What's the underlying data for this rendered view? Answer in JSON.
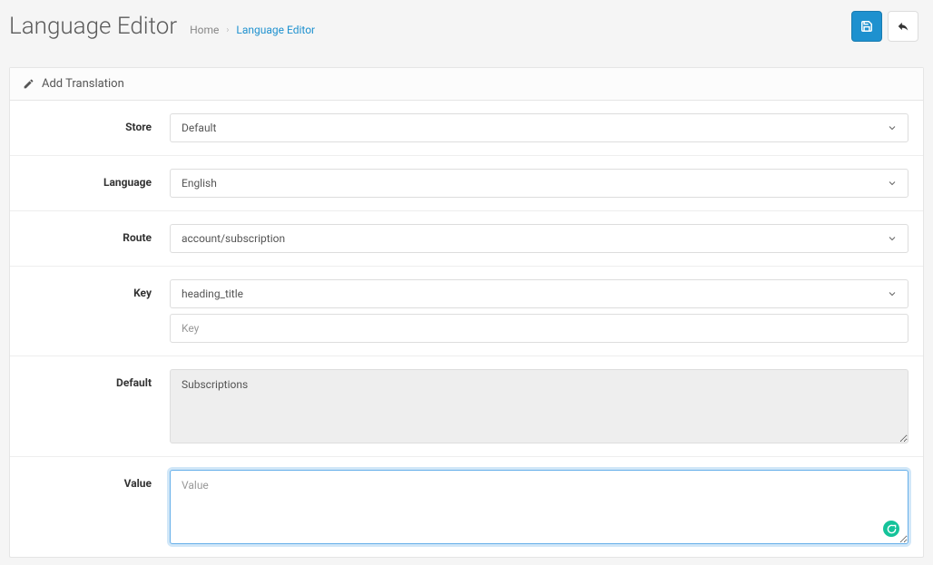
{
  "header": {
    "title": "Language Editor",
    "breadcrumb": {
      "home": "Home",
      "current": "Language Editor"
    }
  },
  "panel": {
    "title": "Add Translation"
  },
  "form": {
    "store": {
      "label": "Store",
      "value": "Default"
    },
    "language": {
      "label": "Language",
      "value": "English"
    },
    "route": {
      "label": "Route",
      "value": "account/subscription"
    },
    "key": {
      "label": "Key",
      "value": "heading_title",
      "placeholder": "Key",
      "input_value": ""
    },
    "default": {
      "label": "Default",
      "value": "Subscriptions"
    },
    "value": {
      "label": "Value",
      "placeholder": "Value",
      "value": ""
    }
  }
}
